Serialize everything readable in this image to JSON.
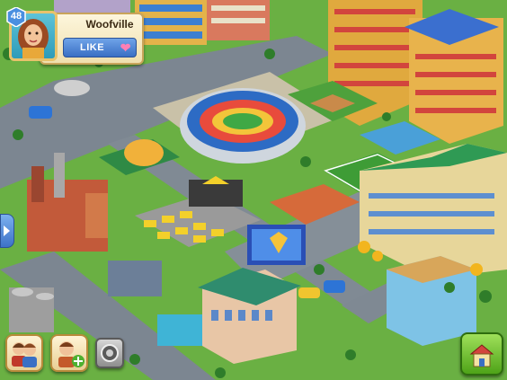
{
  "profile": {
    "level": "48",
    "city_name": "Woofville",
    "like_label": "LIKE"
  },
  "icons": {
    "heart": "heart-icon",
    "side_arrow": "arrow-right-icon",
    "friends": "friends-icon",
    "add_friend": "add-friend-icon",
    "achievements": "badge-icon",
    "build": "build-icon"
  },
  "colors": {
    "like_button": "#3a6fc4",
    "build_button": "#4ea318",
    "panel": "#f0dfae"
  }
}
